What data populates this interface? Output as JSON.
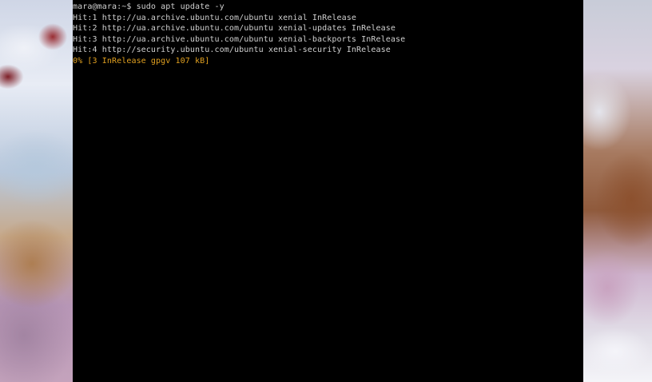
{
  "colors": {
    "terminal_bg": "#000000",
    "text": "#d0d0d0",
    "progress": "#e0a020"
  },
  "terminal": {
    "lines": [
      "mara@mara:~$ sudo apt update -y",
      "Hit:1 http://ua.archive.ubuntu.com/ubuntu xenial InRelease",
      "Hit:2 http://ua.archive.ubuntu.com/ubuntu xenial-updates InRelease",
      "Hit:3 http://ua.archive.ubuntu.com/ubuntu xenial-backports InRelease",
      "Hit:4 http://security.ubuntu.com/ubuntu xenial-security InRelease"
    ],
    "progress_line": "0% [3 InRelease gpgv 107 kB]"
  }
}
